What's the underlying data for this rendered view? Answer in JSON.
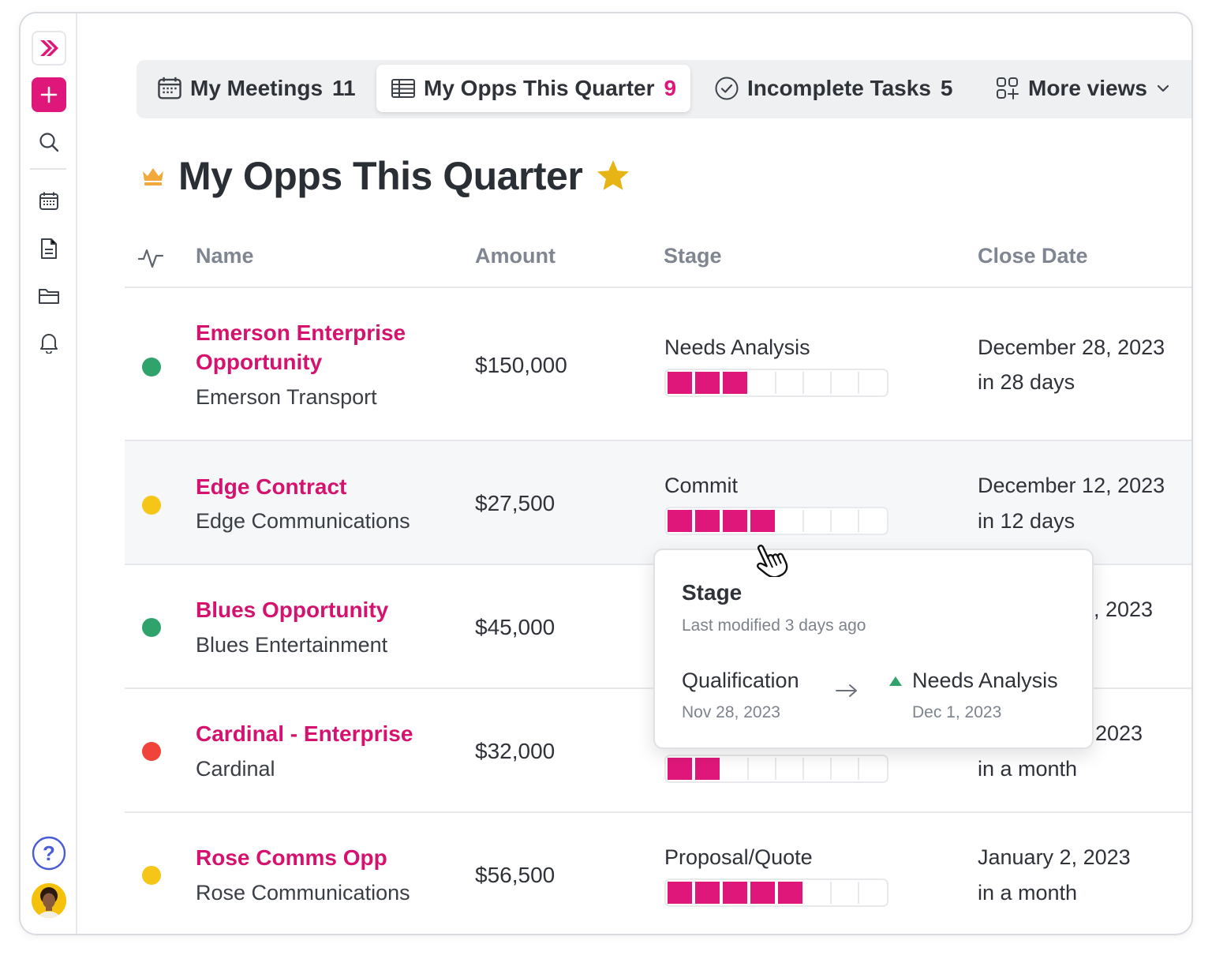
{
  "colors": {
    "brand": "#e0177a",
    "status_green": "#2fa36b",
    "status_yellow": "#f5c518",
    "status_red": "#f0443a",
    "star": "#e7b416"
  },
  "sidebar": {
    "items": [
      {
        "name": "logo",
        "icon": "brand-logo-icon"
      },
      {
        "name": "add",
        "icon": "plus-icon"
      },
      {
        "name": "search",
        "icon": "search-icon"
      },
      {
        "name": "calendar",
        "icon": "calendar-icon"
      },
      {
        "name": "documents",
        "icon": "document-icon"
      },
      {
        "name": "folders",
        "icon": "folder-icon"
      },
      {
        "name": "notifications",
        "icon": "bell-icon"
      },
      {
        "name": "help",
        "icon": "help-icon",
        "label": "?"
      },
      {
        "name": "profile",
        "icon": "avatar"
      }
    ]
  },
  "tabs": [
    {
      "label": "My Meetings",
      "count": "11",
      "icon": "calendar-icon"
    },
    {
      "label": "My Opps This Quarter",
      "count": "9",
      "icon": "table-icon",
      "active": true
    },
    {
      "label": "Incomplete Tasks",
      "count": "5",
      "icon": "check-circle-icon"
    },
    {
      "label": "More views",
      "icon": "views-grid-icon"
    }
  ],
  "page": {
    "title": "My Opps This Quarter",
    "title_icon": "crown-icon",
    "favorite_icon": "star-icon"
  },
  "table": {
    "columns": [
      "Name",
      "Amount",
      "Stage",
      "Close Date"
    ],
    "activity_icon": "activity-icon",
    "stage_segments_total": 8,
    "rows": [
      {
        "name": "Emerson Enterprise Opportunity",
        "company": "Emerson Transport",
        "amount": "$150,000",
        "stage": "Needs Analysis",
        "stage_filled": 3,
        "close_date": "December 28, 2023",
        "relative": "in 28 days",
        "status": "green"
      },
      {
        "name": "Edge Contract",
        "company": "Edge Communications",
        "amount": "$27,500",
        "stage": "Commit",
        "stage_filled": 4,
        "close_date": "December 12, 2023",
        "relative": "in 12 days",
        "status": "yellow"
      },
      {
        "name": "Blues Opportunity",
        "company": "Blues Entertainment",
        "amount": "$45,000",
        "stage": "",
        "stage_filled": null,
        "close_date": ", 2023",
        "relative": "",
        "status": "green"
      },
      {
        "name": "Cardinal - Enterprise",
        "company": "Cardinal",
        "amount": "$32,000",
        "stage": "",
        "stage_filled": 2,
        "close_date": "2023",
        "relative": "in a month",
        "status": "red"
      },
      {
        "name": "Rose Comms Opp",
        "company": "Rose Communications",
        "amount": "$56,500",
        "stage": "Proposal/Quote",
        "stage_filled": 5,
        "close_date": "January 2, 2023",
        "relative": "in a month",
        "status": "yellow"
      }
    ]
  },
  "popover": {
    "title": "Stage",
    "subtitle": "Last modified 3 days ago",
    "from_stage": "Qualification",
    "from_date": "Nov 28, 2023",
    "to_stage": "Needs Analysis",
    "to_date": "Dec 1, 2023",
    "arrow_icon": "arrow-right-icon",
    "trend_icon": "triangle-up-icon"
  },
  "cursor": {
    "icon": "hand-pointer-icon"
  }
}
